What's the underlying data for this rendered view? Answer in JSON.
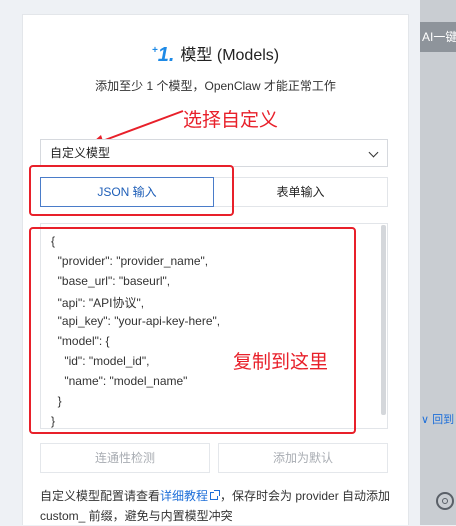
{
  "side": {
    "top_text": "AI一键",
    "back_text": "∨ 回到"
  },
  "header": {
    "step_number": "1.",
    "title": "模型 (Models)",
    "subtitle": "添加至少 1 个模型，OpenClaw 才能正常工作"
  },
  "annotations": {
    "select_hint": "选择自定义",
    "copy_hint": "复制到这里"
  },
  "model_select": {
    "value": "自定义模型"
  },
  "tabs": {
    "json_label": "JSON 输入",
    "form_label": "表单输入"
  },
  "editor": {
    "lines": [
      "{",
      "  \"provider\": \"provider_name\",",
      "  \"base_url\": \"baseurl\",",
      "  \"api\": \"API协议\",",
      "  \"api_key\": \"your-api-key-here\",",
      "  \"model\": {",
      "    \"id\": \"model_id\",",
      "    \"name\": \"model_name\"",
      "  }",
      "}"
    ]
  },
  "buttons": {
    "test_label": "连通性检测",
    "default_label": "添加为默认"
  },
  "note": {
    "prefix": "自定义模型配置请查看",
    "link": "详细教程",
    "suffix": "，保存时会为 provider 自动添加 custom_ 前缀，避免与内置模型冲突"
  },
  "colors": {
    "accent": "#1e8ae6",
    "annotation_red": "#e8202a",
    "tab_border": "#4a7cc9"
  }
}
